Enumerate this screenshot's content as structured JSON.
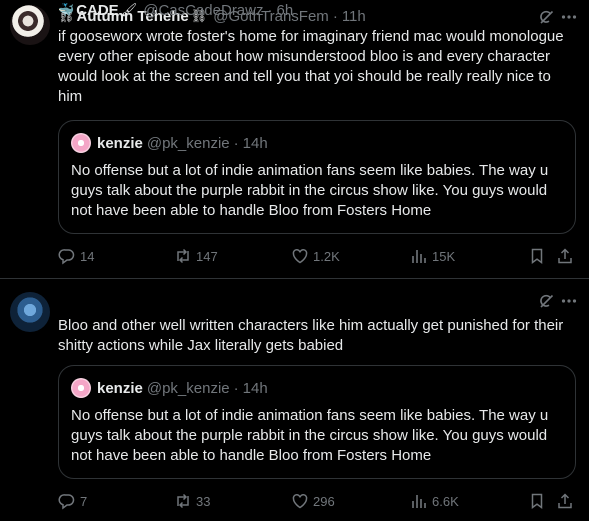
{
  "tweets": [
    {
      "author": "Autumn Tehehe",
      "emoji": "⛓",
      "handle": "@GothTransFem",
      "time": "11h",
      "text": "if gooseworx wrote foster's home for imaginary friend mac would monologue every other episode about how misunderstood bloo is and every character would look at the screen and tell you that yoi should be really really nice to him",
      "quote": {
        "author": "kenzie",
        "handle": "@pk_kenzie",
        "time": "14h",
        "text": "No offense but a lot of indie animation fans seem like babies. The way u guys talk about the purple rabbit in the circus show like. You guys would not have been able to handle Bloo from Fosters Home"
      },
      "stats": {
        "replies": "14",
        "reposts": "147",
        "likes": "1.2K",
        "views": "15K"
      }
    },
    {
      "author": "CADE",
      "emoji_before": "🐳",
      "emoji_after": "🖌",
      "handle": "@CasCadeDrawz",
      "time": "6h",
      "text": "Bloo and other well written characters like him actually get punished for their shitty actions while Jax literally gets babied",
      "quote": {
        "author": "kenzie",
        "handle": "@pk_kenzie",
        "time": "14h",
        "text": "No offense but a lot of indie animation fans seem like babies. The way u guys talk about the purple rabbit in the circus show like. You guys would not have been able to handle Bloo from Fosters Home"
      },
      "stats": {
        "replies": "7",
        "reposts": "33",
        "likes": "296",
        "views": "6.6K"
      }
    }
  ],
  "separator": "·",
  "icons": [
    "grok-icon",
    "more-icon",
    "reply-icon",
    "repost-icon",
    "like-icon",
    "views-icon",
    "bookmark-icon",
    "share-icon"
  ],
  "colors": {
    "background": "#000000",
    "text": "#e7e9ea",
    "muted": "#71767b",
    "border": "#2f3336"
  }
}
